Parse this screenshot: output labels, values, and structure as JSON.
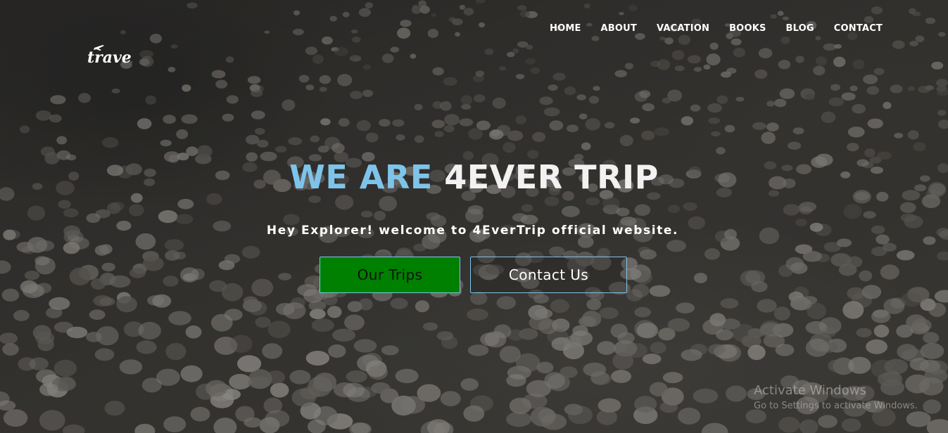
{
  "logo": {
    "text": "travel"
  },
  "nav": {
    "items": [
      "HOME",
      "ABOUT",
      "VACATION",
      "BOOKS",
      "BLOG",
      "CONTACT"
    ]
  },
  "hero": {
    "headline_accent": "WE ARE",
    "headline_main": "4EVER TRIP",
    "subtitle": "Hey Explorer! welcome to 4EverTrip official website.",
    "buttons": {
      "trips": "Our Trips",
      "contact": "Contact Us"
    }
  },
  "watermark": {
    "title": "Activate Windows",
    "subtitle": "Go to Settings to activate Windows."
  },
  "colors": {
    "accent": "#7ec4ea",
    "trips_button_bg": "#008000",
    "text_light": "#ffffff"
  },
  "icons": [
    "airplane-icon"
  ]
}
